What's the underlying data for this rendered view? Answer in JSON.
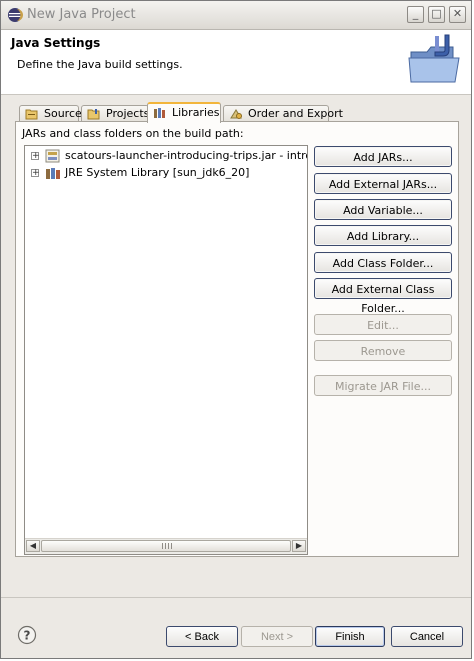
{
  "window": {
    "title": "New Java Project",
    "controls": {
      "minimize": "_",
      "maximize": "□",
      "close": "✕"
    }
  },
  "header": {
    "title": "Java Settings",
    "description": "Define the Java build settings."
  },
  "tabs": [
    {
      "label": "Source",
      "icon": "source-folder-icon",
      "active": false
    },
    {
      "label": "Projects",
      "icon": "projects-icon",
      "active": false
    },
    {
      "label": "Libraries",
      "icon": "libraries-icon",
      "active": true
    },
    {
      "label": "Order and Export",
      "icon": "order-export-icon",
      "active": false
    }
  ],
  "libraries_panel": {
    "label": "JARs and class folders on the build path:",
    "entries": [
      {
        "label": "scatours-launcher-introducing-trips.jar - introducing-t",
        "icon": "jar-icon",
        "expander": "+"
      },
      {
        "label": "JRE System Library [sun_jdk6_20]",
        "icon": "library-icon",
        "expander": "+"
      }
    ],
    "scroll": {
      "left": "◀",
      "right": "▶"
    },
    "buttons": {
      "add_jars": "Add JARs...",
      "add_external_jars": "Add External JARs...",
      "add_variable": "Add Variable...",
      "add_library": "Add Library...",
      "add_class_folder": "Add Class Folder...",
      "add_external_class_folder": "Add External Class Folder...",
      "edit": "Edit...",
      "remove": "Remove",
      "migrate_jar": "Migrate JAR File..."
    }
  },
  "footer": {
    "help": "?",
    "back": "< Back",
    "next": "Next >",
    "finish": "Finish",
    "cancel": "Cancel"
  },
  "colors": {
    "dialog_bg": "#ece9e4",
    "active_tab_accent": "#f2b53b",
    "button_border": "#3c4a6d"
  }
}
